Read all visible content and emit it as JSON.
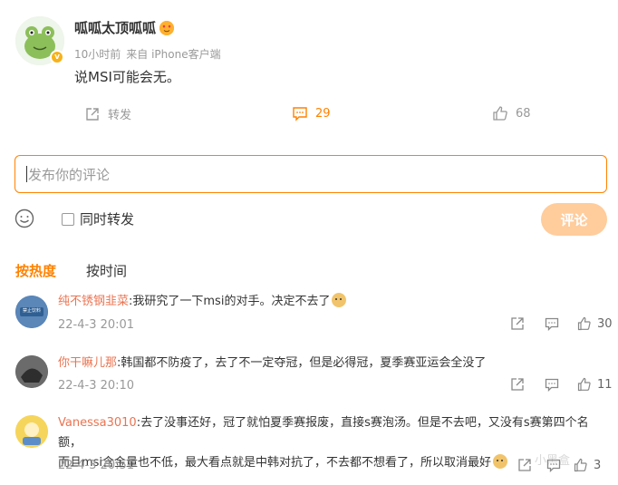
{
  "post": {
    "author": "呱呱太顶呱呱",
    "time": "10小时前",
    "source": "来自 iPhone客户端",
    "text": "说MSI可能会无。",
    "repost_label": "转发",
    "comment_count": "29",
    "like_count": "68"
  },
  "composer": {
    "placeholder": "发布你的评论",
    "repost_label": "同时转发",
    "submit_label": "评论"
  },
  "tabs": {
    "hot": "按热度",
    "time": "按时间"
  },
  "comments": [
    {
      "name": "纯不锈钢韭菜",
      "text": ":我研究了一下msi的对手。决定不去了",
      "time": "22-4-3 20:01",
      "likes": "30",
      "avatar_text": "禁止饮料"
    },
    {
      "name": "你干嘛儿那",
      "text": ":韩国都不防疫了，去了不一定夺冠，但是必得冠，夏季赛亚运会全没了",
      "time": "22-4-3 20:10",
      "likes": "11"
    },
    {
      "name": "Vanessa3010",
      "text": ":去了没事还好，冠了就怕夏季赛报废，直接s赛泡汤。但是不去吧，又没有s赛第四个名额，",
      "text2": "而且msi含金量也不低，最大看点就是中韩对抗了，不去都不想看了，所以取消最好",
      "time": "22-4-3 20:51",
      "likes": "3"
    }
  ],
  "watermark": "小黑盒",
  "colors": {
    "accent": "#ff8200",
    "name": "#eb7350",
    "submit_bg": "#ffcc9c"
  }
}
